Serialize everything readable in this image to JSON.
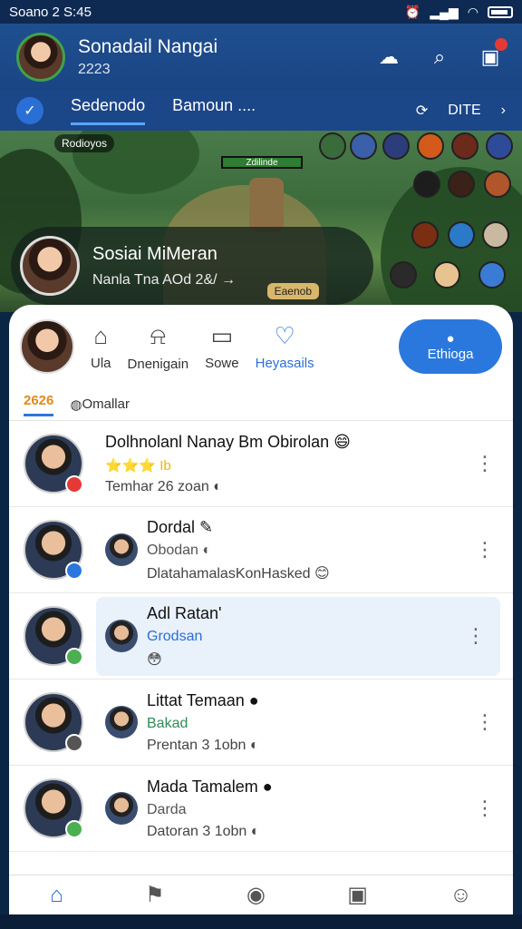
{
  "status_bar": {
    "left": "Soano 2 S:45",
    "right_icons": [
      "alarm-icon",
      "signal-icon",
      "wifi-icon",
      "battery-icon"
    ]
  },
  "header": {
    "name": "Sonadail Nangai",
    "sub": "2223"
  },
  "tabs": {
    "items": [
      "Sedenodo",
      "Bamoun ...."
    ],
    "right_label": "DITE"
  },
  "game": {
    "hud": "Rodioyos",
    "hp": "Zdilinde",
    "live_name": "Sosiai MiMeran",
    "live_sub": "Nanla Tna AOd 2&/ →",
    "live_tag": "Eaenob"
  },
  "panel_nav": [
    {
      "label": "Ula",
      "icon": "home-icon"
    },
    {
      "label": "Dnenigain",
      "icon": "bell-icon"
    },
    {
      "label": "Sowe",
      "icon": "message-icon"
    },
    {
      "label": "Heyasails",
      "icon": "heart-icon"
    }
  ],
  "panel_primary": "Ethioga",
  "sub_row": {
    "count": "2626",
    "link": "Omallar"
  },
  "friends": [
    {
      "name": "Dolhnolanl Nanay Bm Obirolan 😄",
      "line2": "⭐⭐⭐ Ib",
      "line3": "Temhar 26 zoan ◐",
      "badge": "#e53935",
      "style": "normal"
    },
    {
      "name": "Dordal ✎",
      "line2": "Obodan ◐",
      "line3": "DlatahamalasKonHasked 😊",
      "badge": "#2a78dd",
      "style": "normal"
    },
    {
      "name": "Adl Ratan'",
      "line2": "Grodsan",
      "line3": "😳",
      "badge": "#4caf50",
      "style": "blue-highlight"
    },
    {
      "name": "Littat Temaan ●",
      "line2": "Bakad",
      "line3": "Prentan 3 1obn ◐",
      "badge": "#555555",
      "style": "green"
    },
    {
      "name": "Mada Tamalem ●",
      "line2": "Darda",
      "line3": "Datoran 3 1obn ◐",
      "badge": "#4caf50",
      "style": "normal"
    }
  ],
  "bottom_nav": [
    "home-icon",
    "flag-icon",
    "camera-icon",
    "photo-icon",
    "profile-icon"
  ]
}
